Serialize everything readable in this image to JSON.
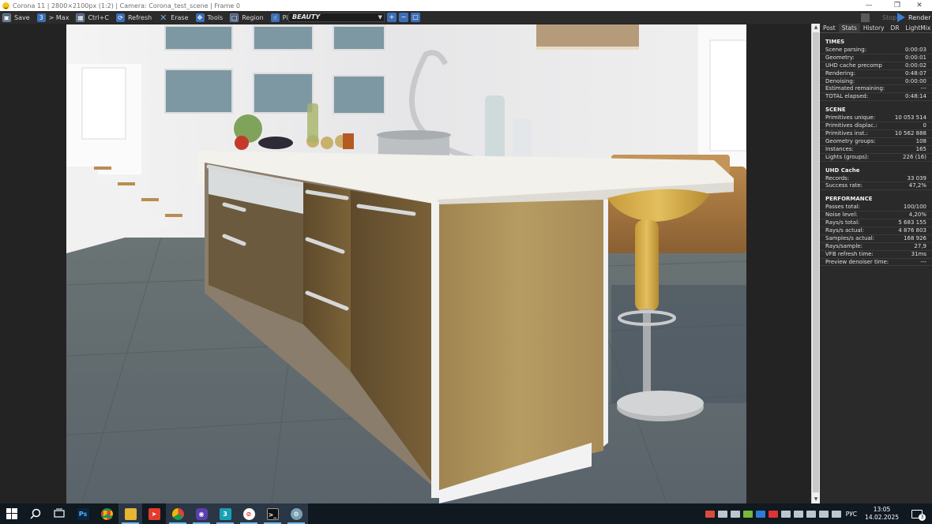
{
  "titlebar": {
    "title": "Corona 11 | 2800×2100px (1:2) | Camera: Corona_test_scene | Frame 0"
  },
  "toolbar": {
    "save": "Save",
    "max": "> Max",
    "copy": "Ctrl+C",
    "refresh": "Refresh",
    "erase": "Erase",
    "tools": "Tools",
    "region": "Region",
    "pick": "Pick",
    "pass": "BEAUTY",
    "stop": "Stop",
    "render": "Render"
  },
  "panel": {
    "tabs": [
      "Post",
      "Stats",
      "History",
      "DR",
      "LightMix"
    ],
    "active_tab": "Stats",
    "times": {
      "title": "TIMES",
      "rows": [
        [
          "Scene parsing:",
          "0:00:03"
        ],
        [
          "Geometry:",
          "0:00:01"
        ],
        [
          "UHD cache precomp",
          "0:00:02"
        ],
        [
          "Rendering:",
          "0:48:07"
        ],
        [
          "Denoising:",
          "0:00:00"
        ],
        [
          "Estimated remaining:",
          "---"
        ],
        [
          "TOTAL elapsed:",
          "0:48:14"
        ]
      ]
    },
    "scene": {
      "title": "SCENE",
      "rows": [
        [
          "Primitives unique:",
          "10 053 514"
        ],
        [
          "Primitives displac.:",
          "0"
        ],
        [
          "Primitives inst.:",
          "10 562 888"
        ],
        [
          "Geometry groups:",
          "108"
        ],
        [
          "Instances:",
          "165"
        ],
        [
          "Lights (groups):",
          "226 (16)"
        ]
      ]
    },
    "uhd": {
      "title": "UHD Cache",
      "rows": [
        [
          "Records:",
          "33 039"
        ],
        [
          "Success rate:",
          "47,2%"
        ]
      ]
    },
    "performance": {
      "title": "PERFORMANCE",
      "rows": [
        [
          "Passes total:",
          "100/100"
        ],
        [
          "Noise level:",
          "4,20%"
        ],
        [
          "Rays/s total:",
          "5 683 155"
        ],
        [
          "Rays/s actual:",
          "4 876 803"
        ],
        [
          "Samples/s actual:",
          "168 926"
        ],
        [
          "Rays/sample:",
          "27,9"
        ],
        [
          "VFB refresh time:",
          "31ms"
        ],
        [
          "Preview denoiser time:",
          "---"
        ]
      ]
    }
  },
  "taskbar": {
    "time": "13:05",
    "date": "14.02.2025",
    "lang": "РУС",
    "notifications": "3",
    "apps": [
      "start",
      "search",
      "task-view",
      "photoshop",
      "chrome",
      "explorer",
      "anydesk",
      "chrome",
      "app-purple",
      "3dsmax",
      "app-red",
      "terminal",
      "app-misc"
    ]
  },
  "colors": {
    "accent": "#3c6fb6",
    "panel_bg": "#2a2a2a",
    "taskbar_bg": "#101820"
  }
}
